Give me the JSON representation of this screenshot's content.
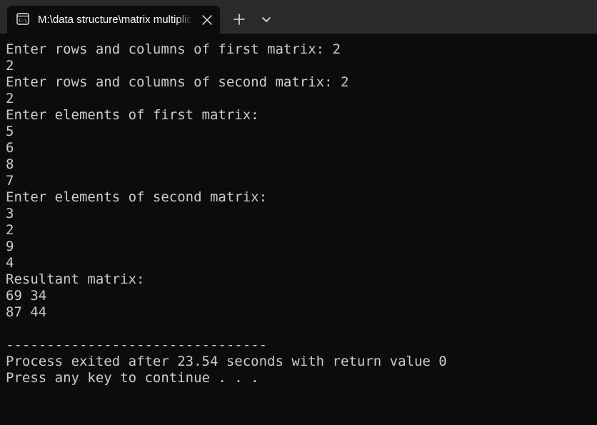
{
  "window": {
    "tab_title": "M:\\data structure\\matrix multiplication.exe",
    "tab_icon": "console-icon",
    "close_icon": "close-icon",
    "new_tab_icon": "plus-icon",
    "dropdown_icon": "chevron-down-icon"
  },
  "colors": {
    "titlebar": "#2a2a2a",
    "background": "#0c0c0c",
    "text": "#cccccc"
  },
  "console": {
    "lines": [
      "Enter rows and columns of first matrix: 2",
      "2",
      "Enter rows and columns of second matrix: 2",
      "2",
      "Enter elements of first matrix:",
      "5",
      "6",
      "8",
      "7",
      "Enter elements of second matrix:",
      "3",
      "2",
      "9",
      "4",
      "Resultant matrix:",
      "69 34",
      "87 44",
      "",
      "--------------------------------",
      "Process exited after 23.54 seconds with return value 0",
      "Press any key to continue . . ."
    ]
  }
}
